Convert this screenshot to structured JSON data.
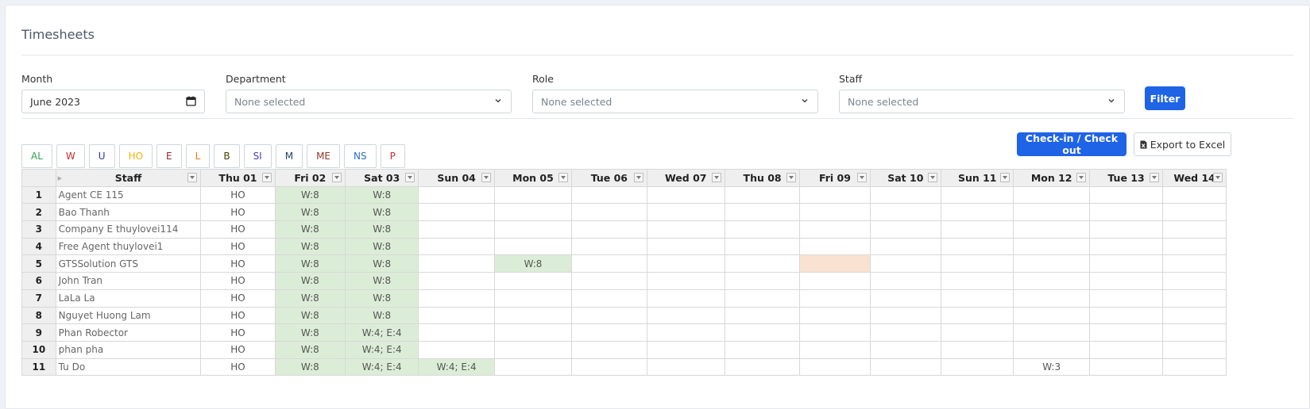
{
  "page": {
    "title": "Timesheets"
  },
  "filters": {
    "month": {
      "label": "Month",
      "value": "June 2023"
    },
    "department": {
      "label": "Department",
      "placeholder": "None selected"
    },
    "role": {
      "label": "Role",
      "placeholder": "None selected"
    },
    "staff": {
      "label": "Staff",
      "placeholder": "None selected"
    },
    "filter_button": "Filter"
  },
  "legend": [
    {
      "code": "AL",
      "color": "#2aa44f"
    },
    {
      "code": "W",
      "color": "#c0302b"
    },
    {
      "code": "U",
      "color": "#2c36b8"
    },
    {
      "code": "HO",
      "color": "#f0b400"
    },
    {
      "code": "E",
      "color": "#8b2a2a"
    },
    {
      "code": "L",
      "color": "#f07a10"
    },
    {
      "code": "B",
      "color": "#444400"
    },
    {
      "code": "SI",
      "color": "#4a3fb0"
    },
    {
      "code": "M",
      "color": "#24426a"
    },
    {
      "code": "ME",
      "color": "#8b3a2a"
    },
    {
      "code": "NS",
      "color": "#2a6fc0"
    },
    {
      "code": "P",
      "color": "#c03030"
    }
  ],
  "actions": {
    "checkin": "Check-in / Check out",
    "export": "Export to Excel"
  },
  "table": {
    "staff_header": "Staff",
    "days": [
      "Thu 01",
      "Fri 02",
      "Sat 03",
      "Sun 04",
      "Mon 05",
      "Tue 06",
      "Wed 07",
      "Thu 08",
      "Fri 09",
      "Sat 10",
      "Sun 11",
      "Mon 12",
      "Tue 13",
      "Wed 14"
    ],
    "rows": [
      {
        "num": "1",
        "name": "Agent CE 115",
        "cells": [
          "HO",
          "W:8",
          "W:8",
          "",
          "",
          "",
          "",
          "",
          "",
          "",
          "",
          "",
          "",
          ""
        ]
      },
      {
        "num": "2",
        "name": "Bao Thanh",
        "cells": [
          "HO",
          "W:8",
          "W:8",
          "",
          "",
          "",
          "",
          "",
          "",
          "",
          "",
          "",
          "",
          ""
        ]
      },
      {
        "num": "3",
        "name": "Company E thuylovei114",
        "cells": [
          "HO",
          "W:8",
          "W:8",
          "",
          "",
          "",
          "",
          "",
          "",
          "",
          "",
          "",
          "",
          ""
        ]
      },
      {
        "num": "4",
        "name": "Free Agent thuylovei1",
        "cells": [
          "HO",
          "W:8",
          "W:8",
          "",
          "",
          "",
          "",
          "",
          "",
          "",
          "",
          "",
          "",
          ""
        ]
      },
      {
        "num": "5",
        "name": "GTSSolution GTS",
        "cells": [
          "HO",
          "W:8",
          "W:8",
          "",
          "W:8",
          "",
          "",
          "",
          "",
          "",
          "",
          "",
          "",
          ""
        ]
      },
      {
        "num": "6",
        "name": "John Tran",
        "cells": [
          "HO",
          "W:8",
          "W:8",
          "",
          "",
          "",
          "",
          "",
          "",
          "",
          "",
          "",
          "",
          ""
        ]
      },
      {
        "num": "7",
        "name": "LaLa La",
        "cells": [
          "HO",
          "W:8",
          "W:8",
          "",
          "",
          "",
          "",
          "",
          "",
          "",
          "",
          "",
          "",
          ""
        ]
      },
      {
        "num": "8",
        "name": "Nguyet Huong Lam",
        "cells": [
          "HO",
          "W:8",
          "W:8",
          "",
          "",
          "",
          "",
          "",
          "",
          "",
          "",
          "",
          "",
          ""
        ]
      },
      {
        "num": "9",
        "name": "Phan Robector",
        "cells": [
          "HO",
          "W:8",
          "W:4; E:4",
          "",
          "",
          "",
          "",
          "",
          "",
          "",
          "",
          "",
          "",
          ""
        ]
      },
      {
        "num": "10",
        "name": "phan pha",
        "cells": [
          "HO",
          "W:8",
          "W:4; E:4",
          "",
          "",
          "",
          "",
          "",
          "",
          "",
          "",
          "",
          "",
          ""
        ]
      },
      {
        "num": "11",
        "name": "Tu Do",
        "cells": [
          "HO",
          "W:8",
          "W:4; E:4",
          "W:4; E:4",
          "",
          "",
          "",
          "",
          "",
          "",
          "",
          "W:3",
          "",
          ""
        ]
      }
    ],
    "highlight_colors": {
      "weekend_green": "#dcedd7",
      "holiday_orange": "#f9e2d2"
    }
  }
}
